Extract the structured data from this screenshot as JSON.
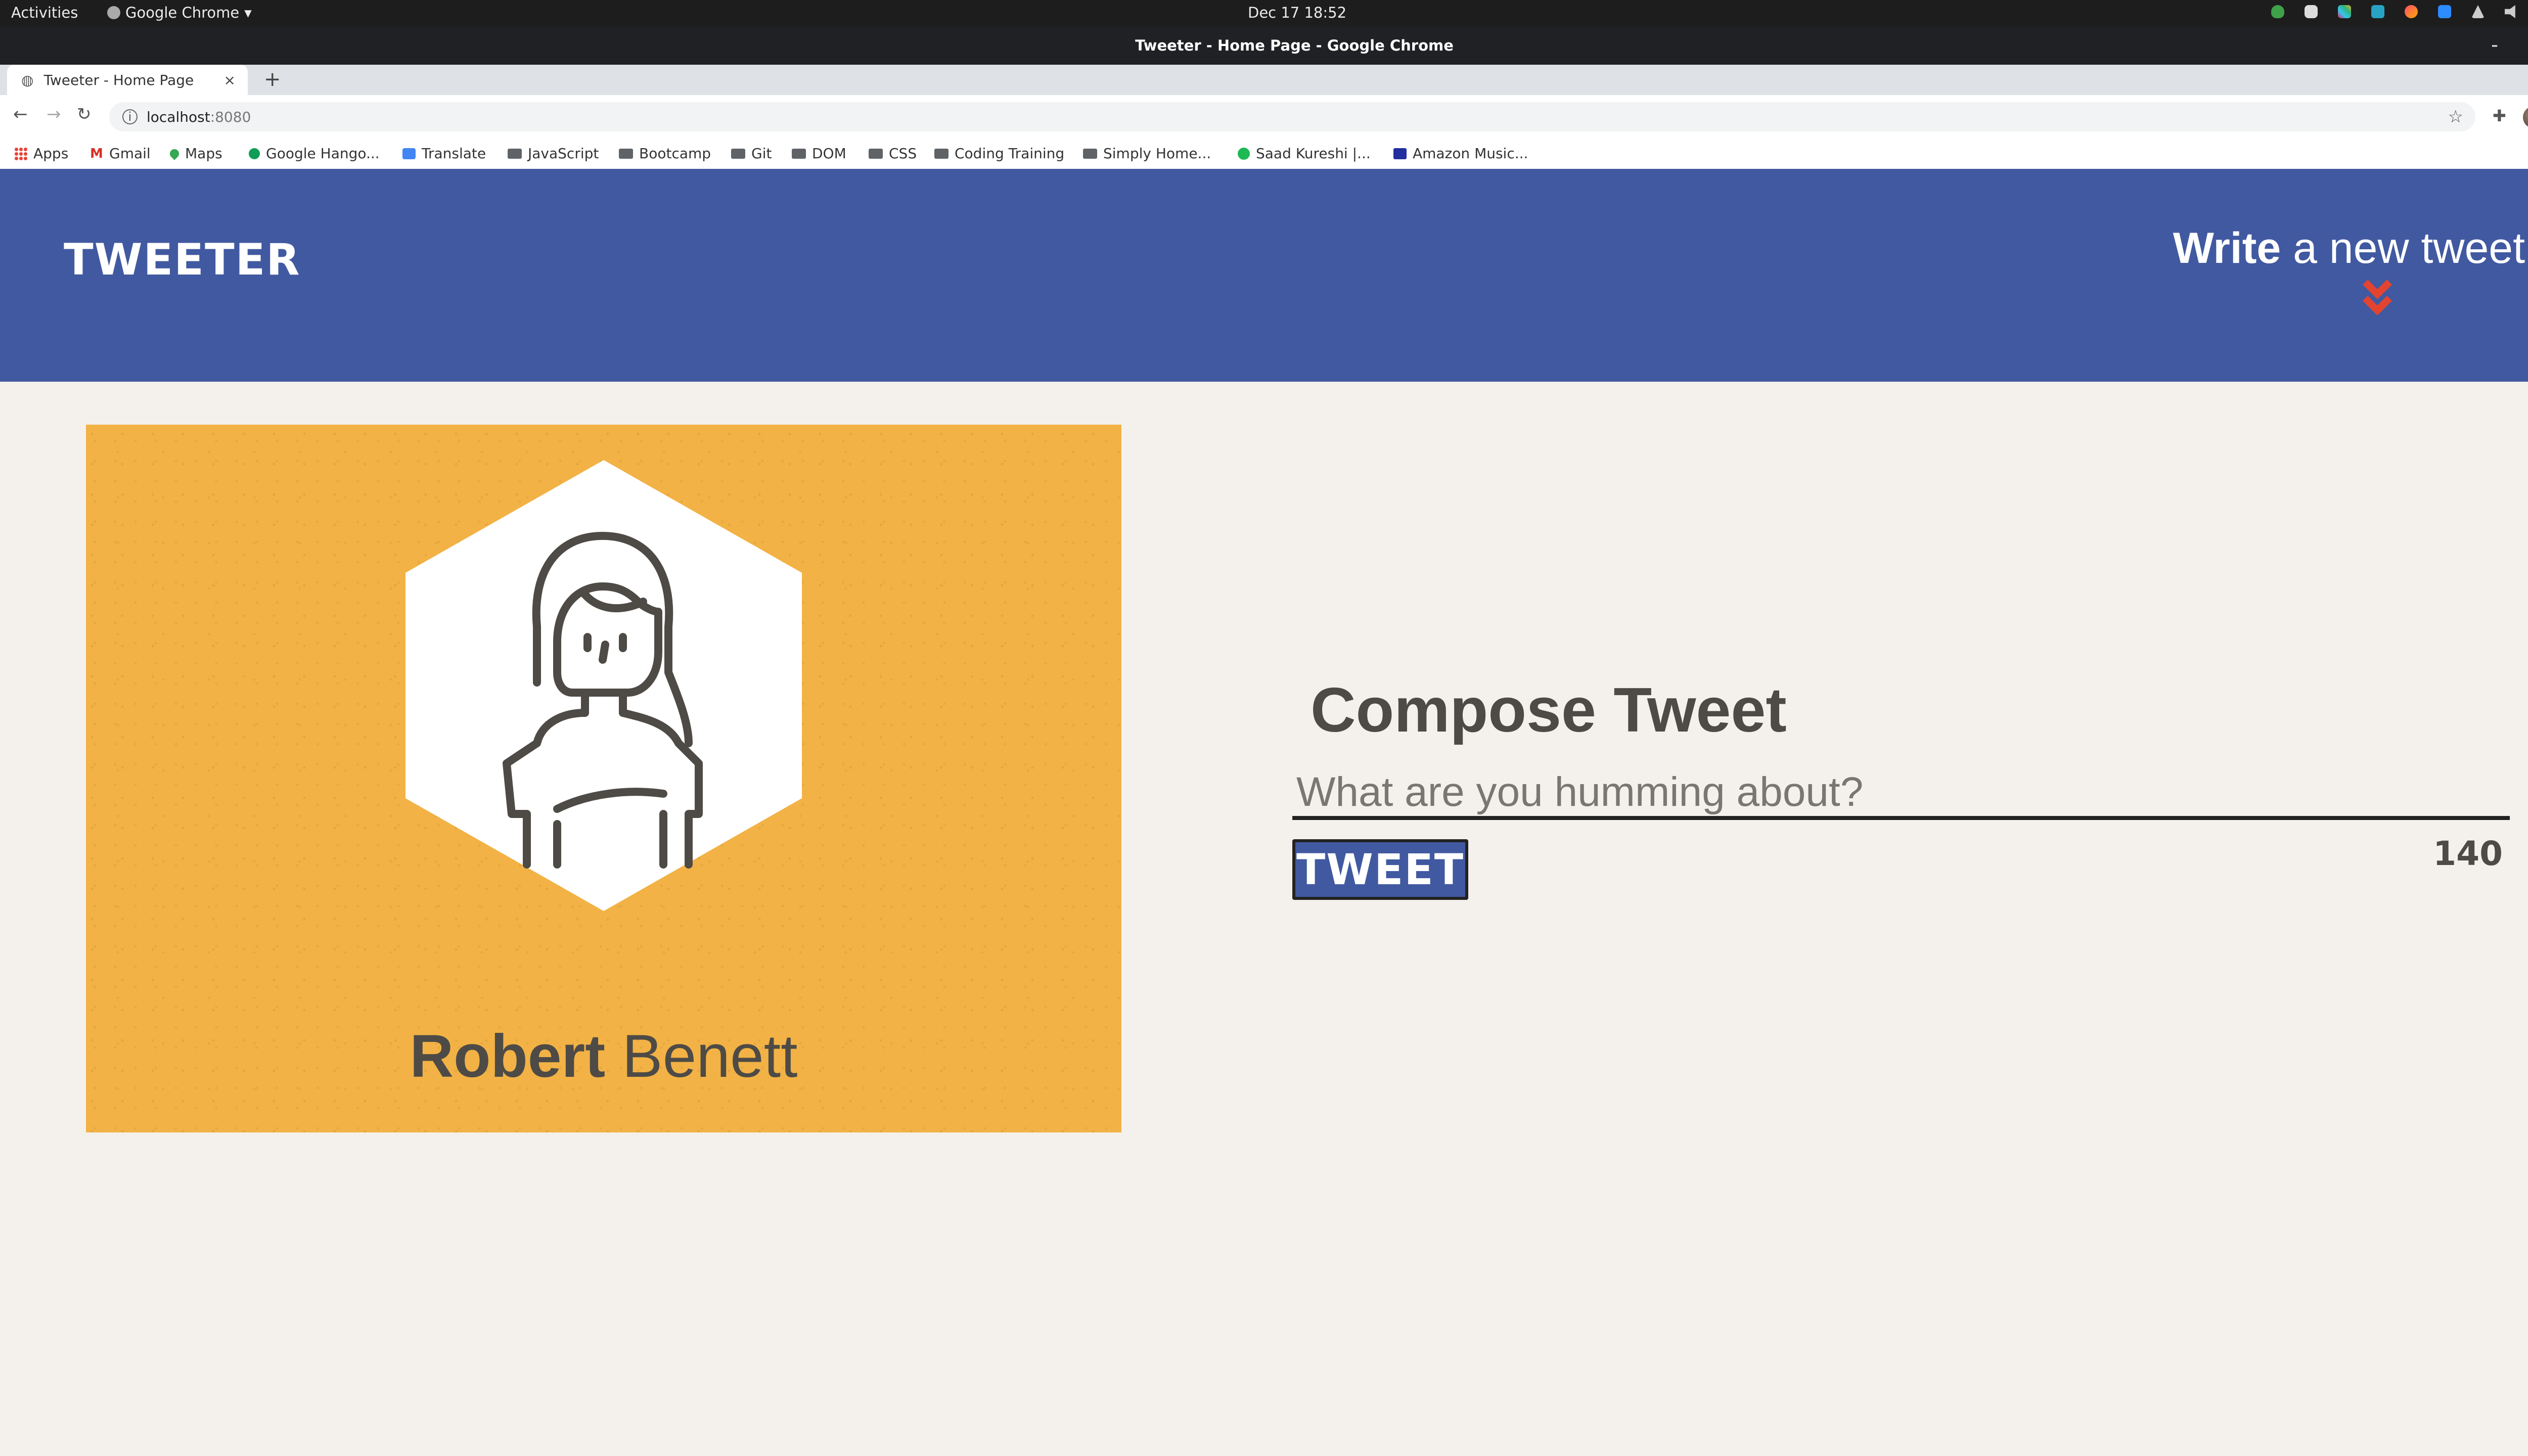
{
  "os": {
    "activities": "Activities",
    "app_name": "Google Chrome",
    "app_menu_arrow": "▾",
    "clock": "Dec 17  18:52",
    "tray_icons": [
      "shield-icon",
      "discord-icon",
      "slack-icon",
      "app-icon",
      "app-icon",
      "zoom-icon",
      "network-icon",
      "volume-icon",
      "mic-icon",
      "power-icon"
    ]
  },
  "window": {
    "title": "Tweeter - Home Page - Google Chrome",
    "minimize": "–",
    "restore": "▫",
    "close": "×"
  },
  "tab": {
    "title": "Tweeter - Home Page",
    "close": "×",
    "new_tab": "+"
  },
  "toolbar": {
    "back": "←",
    "forward": "→",
    "reload": "↻",
    "url_host": "localhost",
    "url_port": ":8080",
    "star": "☆"
  },
  "bookmarks": [
    "Apps",
    "Gmail",
    "Maps",
    "Google Hango...",
    "Translate",
    "JavaScript",
    "Bootcamp",
    "Git",
    "DOM",
    "CSS",
    "Coding Training",
    "Simply Home...",
    "Saad Kureshi |...",
    "Amazon Music..."
  ],
  "header": {
    "logo": "TWEETER",
    "write_bold": "Write",
    "write_rest": " a new tweet"
  },
  "profile": {
    "first_name": "Robert",
    "last_name": " Benett"
  },
  "compose": {
    "title": "Compose Tweet",
    "placeholder": "What are you humming about?",
    "button": "TWEET",
    "counter": "140"
  },
  "colors": {
    "nav": "#4159a0",
    "card": "#f2b245",
    "arrows": "#e2442f",
    "text": "#4e4b46"
  }
}
